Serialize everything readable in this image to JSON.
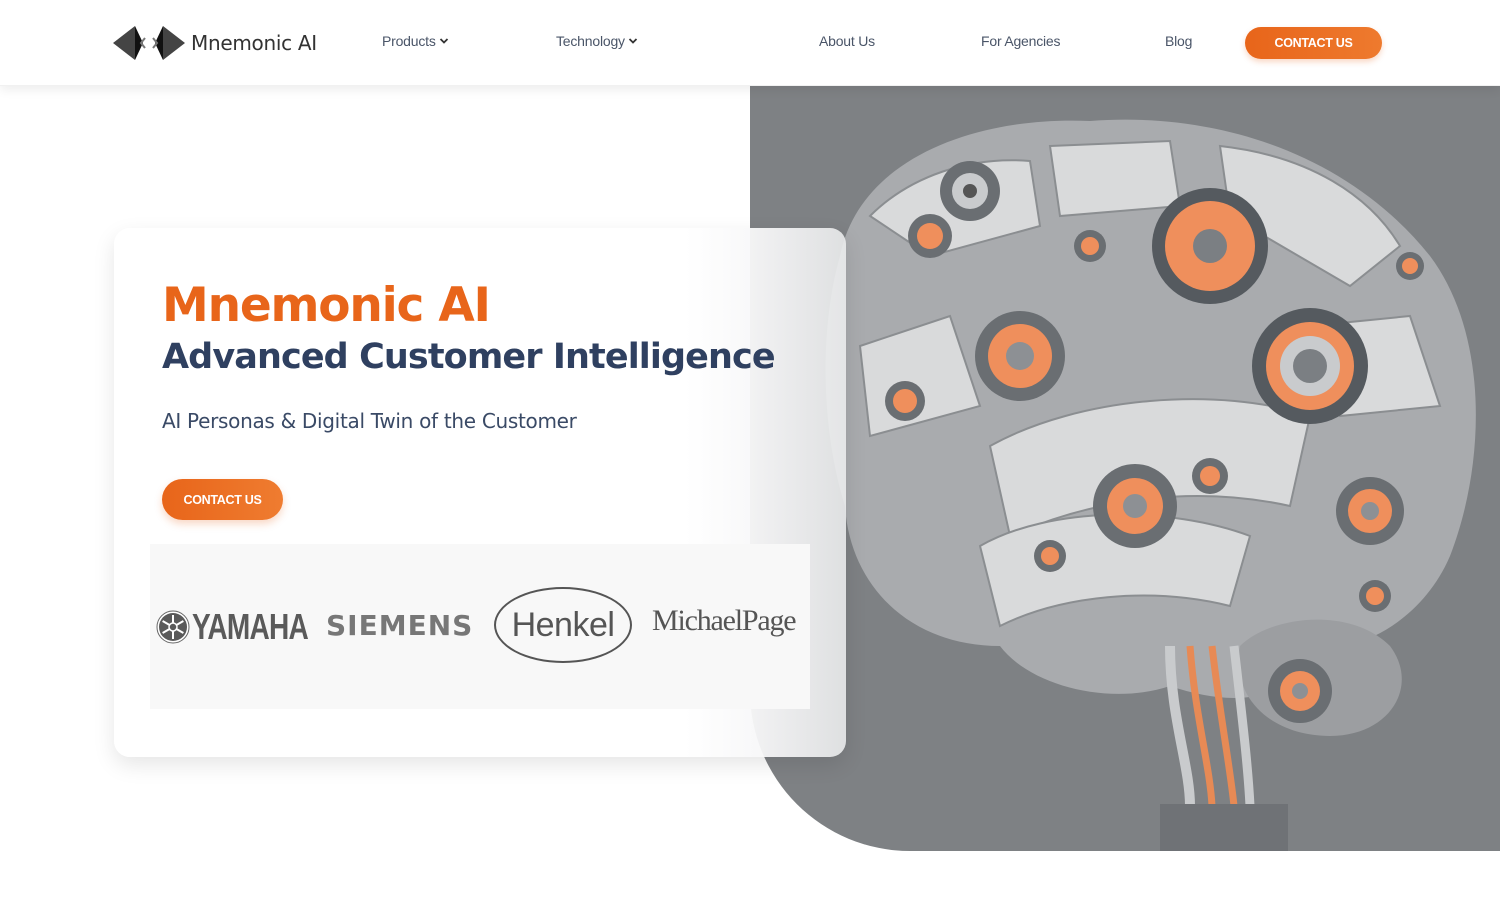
{
  "header": {
    "logo_text": "Mnemonic AI",
    "nav": [
      {
        "label": "Products",
        "has_dropdown": true
      },
      {
        "label": "Technology",
        "has_dropdown": true
      },
      {
        "label": "About Us",
        "has_dropdown": false
      },
      {
        "label": "For Agencies",
        "has_dropdown": false
      },
      {
        "label": "Blog",
        "has_dropdown": false
      }
    ],
    "contact_label": "CONTACT US"
  },
  "hero": {
    "title": "Mnemonic AI",
    "subtitle": "Advanced Customer Intelligence",
    "tagline": "AI Personas & Digital Twin of the Customer",
    "contact_label": "CONTACT US",
    "image_alt": "mechanical-brain-illustration"
  },
  "clients": [
    {
      "name": "YAMAHA"
    },
    {
      "name": "SIEMENS"
    },
    {
      "name": "Henkel"
    },
    {
      "name": "MichaelPage"
    }
  ],
  "colors": {
    "accent": "#e8651a",
    "heading": "#2f4060",
    "hero_bg": "#7e8184"
  }
}
